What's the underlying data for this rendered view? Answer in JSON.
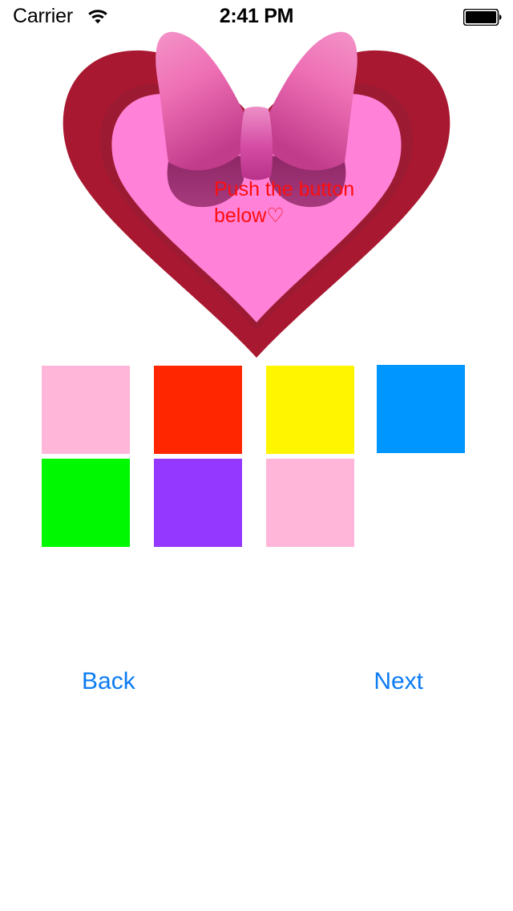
{
  "status_bar": {
    "carrier": "Carrier",
    "wifi_icon": "wifi-icon",
    "time": "2:41 PM",
    "battery_icon": "battery-full-icon"
  },
  "heart": {
    "message": "Push the button below♡",
    "message_color": "#FF0D0D",
    "outer_color": "#A81830",
    "mid_color": "#9C1B32",
    "inner_color": "#FF82D8",
    "bow_color_light": "#F77FC0",
    "bow_color_dark": "#8E2766",
    "bow_knot_color": "#D44BA4"
  },
  "swatches": {
    "rows": [
      [
        {
          "name": "swatch-pink-light",
          "label": "Light Pink",
          "color": "#FFB6D9"
        },
        {
          "name": "swatch-red",
          "label": "Red",
          "color": "#FF2600"
        },
        {
          "name": "swatch-yellow",
          "label": "Yellow",
          "color": "#FFF500"
        },
        {
          "name": "swatch-blue",
          "label": "Blue",
          "color": "#0096FF"
        }
      ],
      [
        {
          "name": "swatch-green",
          "label": "Green",
          "color": "#00F900"
        },
        {
          "name": "swatch-purple",
          "label": "Purple",
          "color": "#9437FF"
        },
        {
          "name": "swatch-pink-light-2",
          "label": "Light Pink",
          "color": "#FFB6D9"
        }
      ]
    ]
  },
  "nav": {
    "back_label": "Back",
    "next_label": "Next",
    "link_color": "#0C7BF3"
  }
}
